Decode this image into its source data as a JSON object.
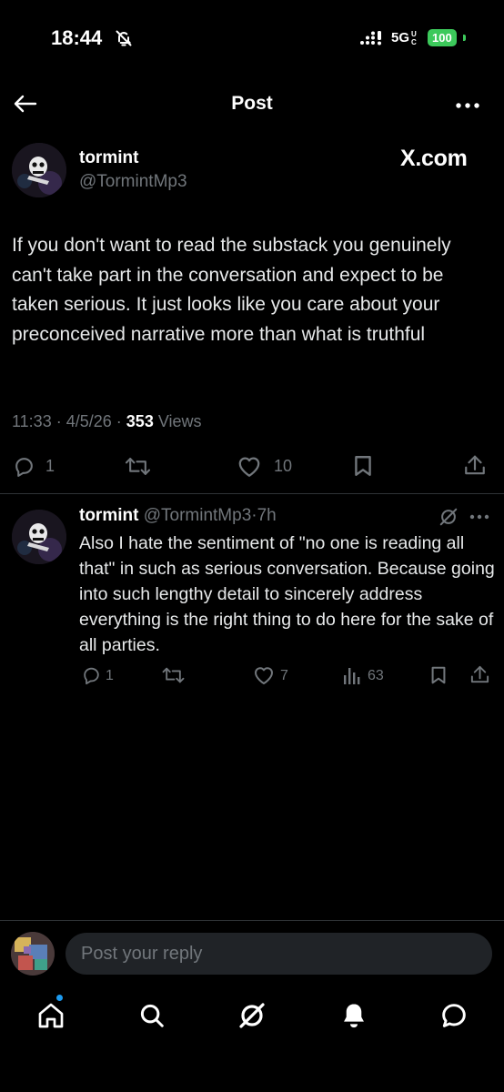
{
  "status_bar": {
    "time": "18:44",
    "network": "5G",
    "network_sub": "UC",
    "battery": "100",
    "icons": [
      "bell-off-icon",
      "signal-icon"
    ]
  },
  "header": {
    "title": "Post",
    "icons": [
      "back-arrow-icon",
      "more-icon"
    ]
  },
  "post": {
    "author_name": "tormint",
    "author_handle": "@TormintMp3",
    "source_badge": "X.com",
    "text": "If you don't want to read the substack you genuinely can't take part in the conversation and expect to be taken serious. It just looks like you care about your preconceived narrative more than what is truthful",
    "time": "11:33",
    "date": "4/5/26",
    "views_count": "353",
    "views_label": "Views",
    "actions": {
      "replies": "1",
      "likes": "10"
    },
    "action_icons": [
      "reply-icon",
      "repost-icon",
      "like-icon",
      "bookmark-icon",
      "share-icon"
    ]
  },
  "reply": {
    "author_name": "tormint",
    "author_handle": "@TormintMp3",
    "age": "7h",
    "text": "Also I hate the sentiment of \"no one is reading all that\" in such as serious conversation. Because going into such lengthy detail to sincerely address everything is the right thing to do here for the sake of all parties.",
    "actions": {
      "replies": "1",
      "likes": "7",
      "views": "63"
    },
    "action_icons": [
      "reply-icon",
      "repost-icon",
      "like-icon",
      "views-icon",
      "bookmark-icon",
      "share-icon"
    ]
  },
  "composer": {
    "placeholder": "Post your reply"
  },
  "bottom_nav": {
    "items": [
      "home-icon",
      "search-icon",
      "grok-icon",
      "notifications-icon",
      "messages-icon"
    ]
  },
  "colors": {
    "background": "#000000",
    "text": "#e7e9ea",
    "secondary": "#71767b",
    "divider": "#2f3336",
    "battery": "#3cc95b",
    "accent": "#1d9bf0"
  }
}
